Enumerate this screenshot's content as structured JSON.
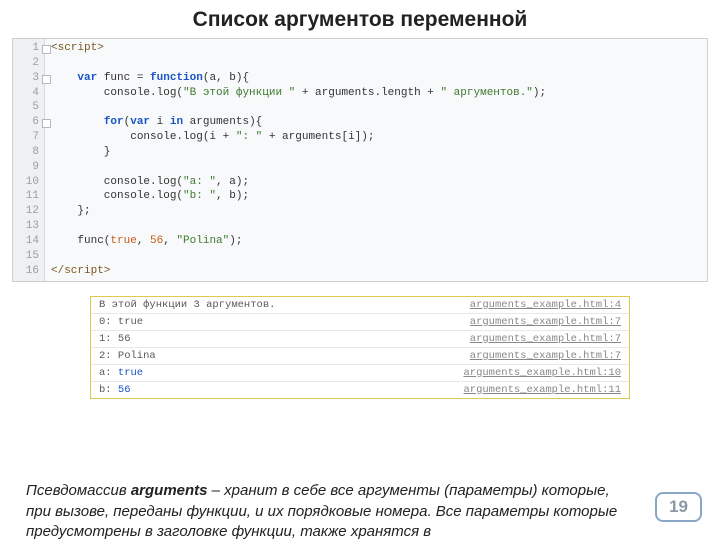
{
  "title": "Список аргументов переменной",
  "code": {
    "lines": [
      {
        "n": 1,
        "html": "<span class='tag'>&lt;script&gt;</span>",
        "fold": true
      },
      {
        "n": 2,
        "html": ""
      },
      {
        "n": 3,
        "html": "    <span class='kw'>var</span> func = <span class='kw'>function</span>(a, b){",
        "fold": true
      },
      {
        "n": 4,
        "html": "        console.log(<span class='str'>\"В этой функции \"</span> + arguments.length + <span class='str'>\" аргументов.\"</span>);"
      },
      {
        "n": 5,
        "html": ""
      },
      {
        "n": 6,
        "html": "        <span class='kw'>for</span>(<span class='kw'>var</span> i <span class='kw'>in</span> arguments){",
        "fold": true
      },
      {
        "n": 7,
        "html": "            console.log(i + <span class='str'>\": \"</span> + arguments[i]);"
      },
      {
        "n": 8,
        "html": "        }"
      },
      {
        "n": 9,
        "html": ""
      },
      {
        "n": 10,
        "html": "        console.log(<span class='str'>\"a: \"</span>, a);"
      },
      {
        "n": 11,
        "html": "        console.log(<span class='str'>\"b: \"</span>, b);"
      },
      {
        "n": 12,
        "html": "    };"
      },
      {
        "n": 13,
        "html": ""
      },
      {
        "n": 14,
        "html": "    func(<span class='bool'>true</span>, <span class='num'>56</span>, <span class='str'>\"Polina\"</span>);"
      },
      {
        "n": 15,
        "html": ""
      },
      {
        "n": 16,
        "html": "<span class='tag'>&lt;/script&gt;</span>"
      }
    ]
  },
  "console": [
    {
      "msg": "В этой функции 3 аргументов.",
      "src": "arguments_example.html:4"
    },
    {
      "msg": "0: true",
      "src": "arguments_example.html:7"
    },
    {
      "msg": "1: 56",
      "src": "arguments_example.html:7"
    },
    {
      "msg": "2: Polina",
      "src": "arguments_example.html:7"
    },
    {
      "msg_html": "a:  <span class='cval-true'>true</span>",
      "src": "arguments_example.html:10"
    },
    {
      "msg_html": "b:  <span class='cval-num'>56</span>",
      "src": "arguments_example.html:11"
    }
  ],
  "description": {
    "pre": "Псевдомассив ",
    "keyword": "arguments",
    "post": " – хранит в себе все аргументы (параметры) которые, при вызове, переданы функции, и их порядковые номера. Все параметры которые предусмотрены в заголовке функции, также хранятся в"
  },
  "page_number": "19"
}
